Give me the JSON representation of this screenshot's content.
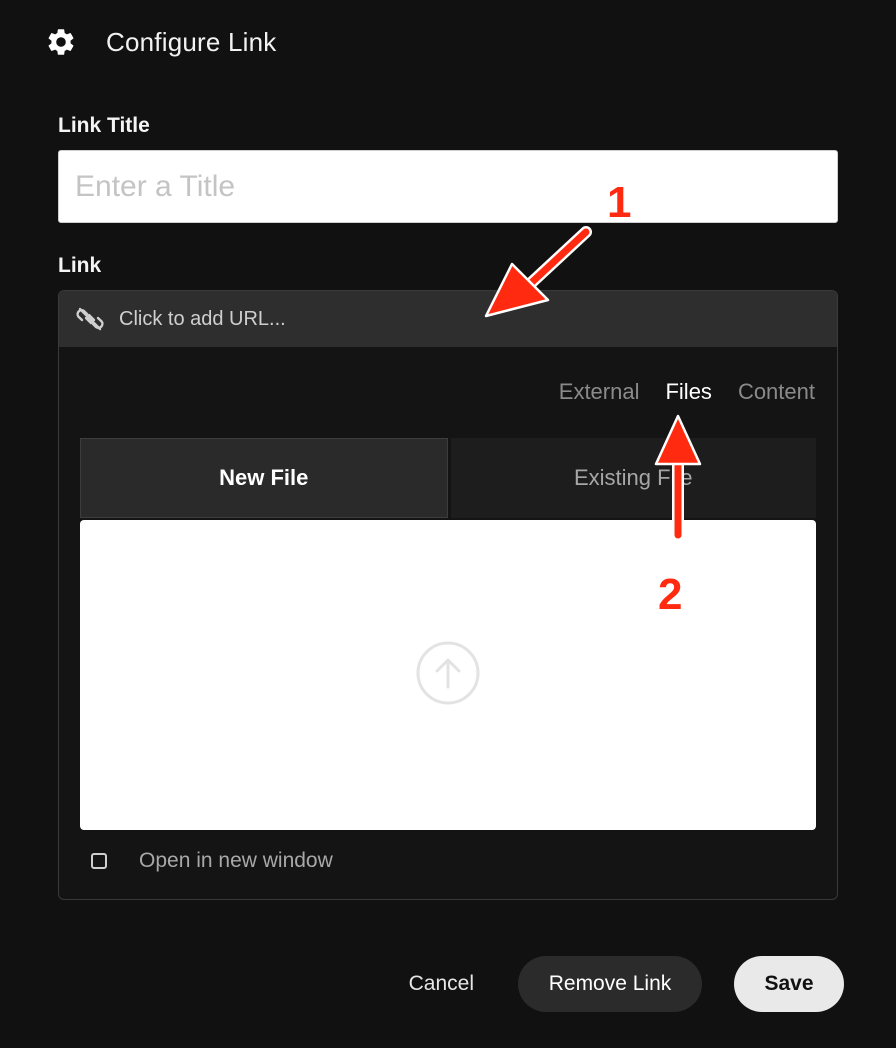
{
  "header": {
    "title": "Configure Link",
    "icon": "gear-icon"
  },
  "link_title": {
    "label": "Link Title",
    "placeholder": "Enter a Title",
    "value": ""
  },
  "link": {
    "label": "Link",
    "url_placeholder": "Click to add URL...",
    "source_tabs": [
      {
        "label": "External",
        "active": false
      },
      {
        "label": "Files",
        "active": true
      },
      {
        "label": "Content",
        "active": false
      }
    ],
    "file_tabs": [
      {
        "label": "New File",
        "active": true
      },
      {
        "label": "Existing File",
        "active": false
      }
    ],
    "upload_icon": "upload-arrow-icon",
    "open_new_window": {
      "label": "Open in new window",
      "checked": false
    }
  },
  "footer": {
    "cancel": "Cancel",
    "remove": "Remove Link",
    "save": "Save"
  },
  "annotations": [
    {
      "label": "1"
    },
    {
      "label": "2"
    }
  ],
  "colors": {
    "background": "#111111",
    "annotation": "#ff2a10"
  }
}
